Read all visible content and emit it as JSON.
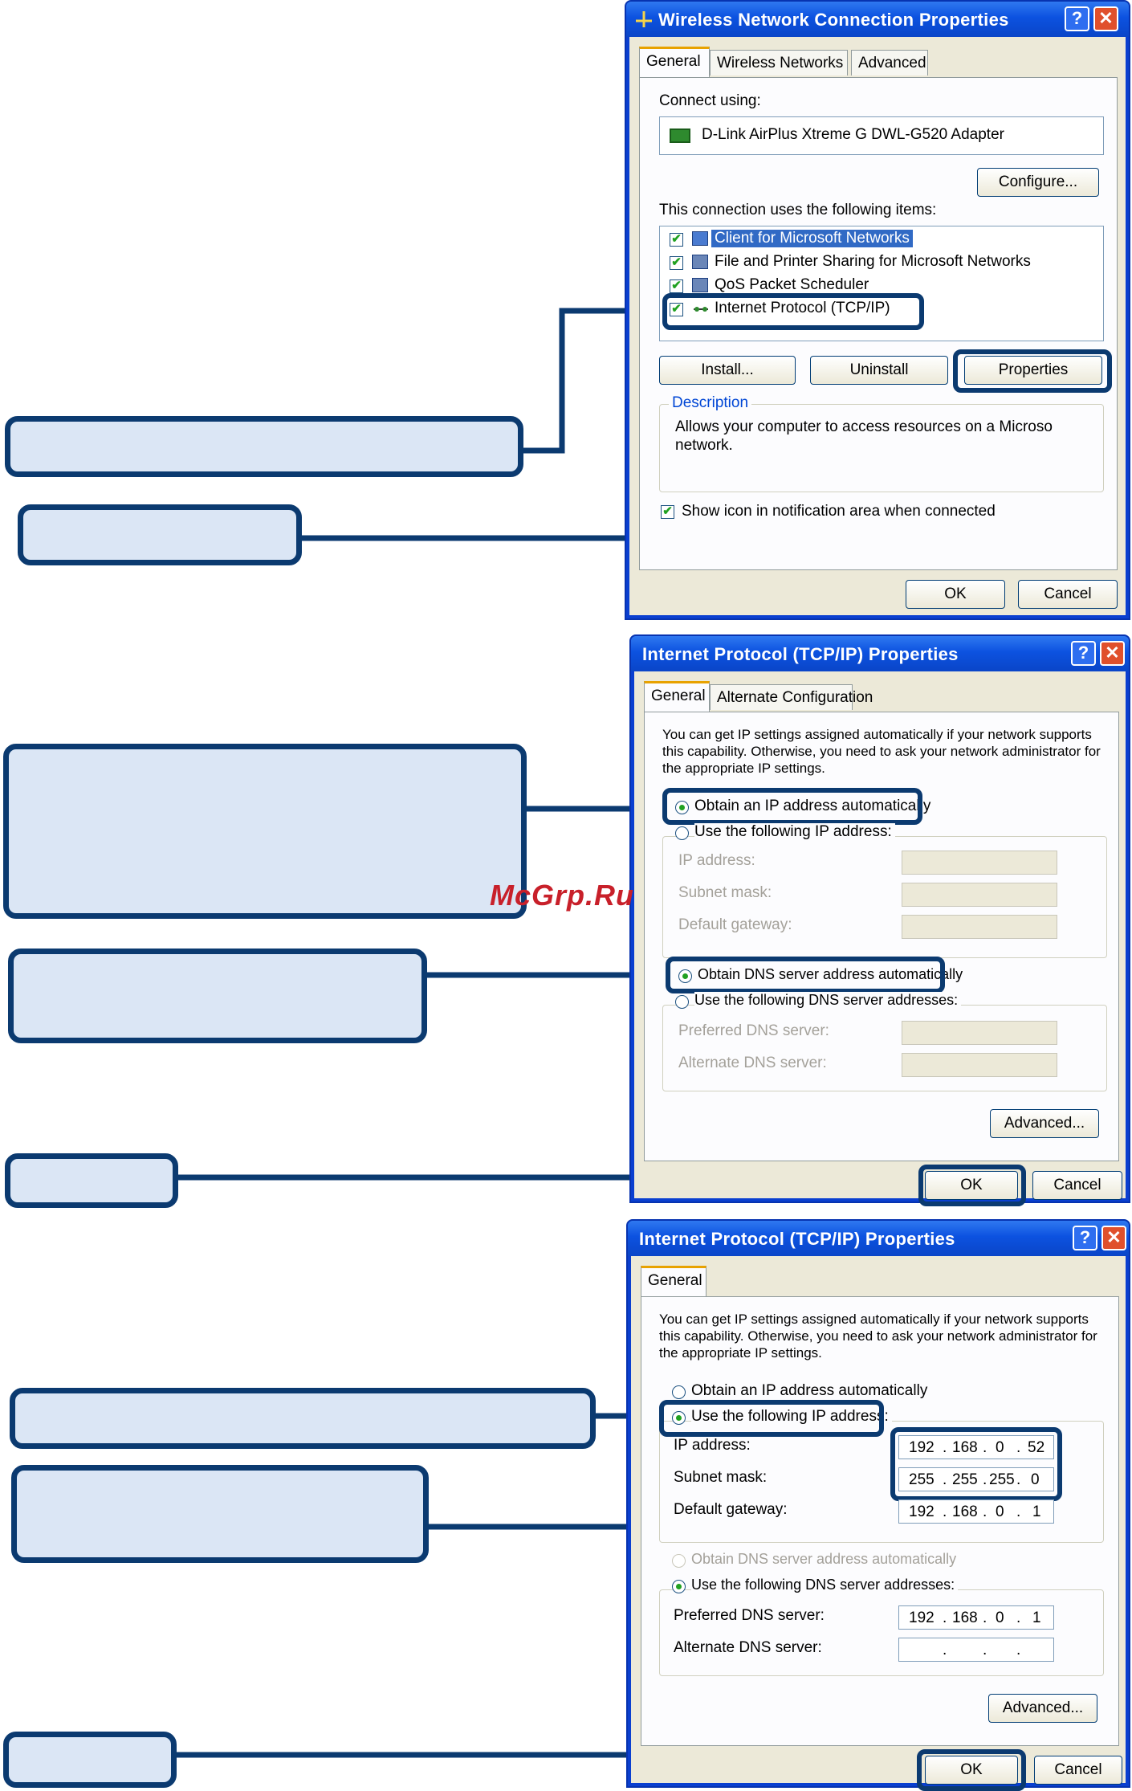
{
  "dialog1": {
    "title": "Wireless Network Connection Properties",
    "tabs": [
      "General",
      "Wireless Networks",
      "Advanced"
    ],
    "connect_using_label": "Connect using:",
    "adapter": "D-Link AirPlus Xtreme G DWL-G520 Adapter",
    "configure_button": "Configure...",
    "items_label": "This connection uses the following items:",
    "items": [
      {
        "label": "Client for Microsoft Networks",
        "checked": true,
        "selected": true
      },
      {
        "label": "File and Printer Sharing for Microsoft Networks",
        "checked": true,
        "selected": false
      },
      {
        "label": "QoS Packet Scheduler",
        "checked": true,
        "selected": false
      },
      {
        "label": "Internet Protocol (TCP/IP)",
        "checked": true,
        "selected": false
      }
    ],
    "install_button": "Install...",
    "uninstall_button": "Uninstall",
    "properties_button": "Properties",
    "description_title": "Description",
    "description_text_1": "Allows your computer to access resources on a Microso",
    "description_text_2": "network.",
    "show_icon_label": "Show icon in notification area when connected",
    "ok_button": "OK",
    "cancel_button": "Cancel"
  },
  "dialog2": {
    "title": "Internet Protocol (TCP/IP) Properties",
    "tabs": [
      "General",
      "Alternate Configuration"
    ],
    "intro_1": "You can get IP settings assigned automatically if your network supports",
    "intro_2": "this capability. Otherwise, you need to ask your network administrator for",
    "intro_3": "the appropriate IP settings.",
    "obtain_ip_auto": "Obtain an IP address automatically",
    "use_following_ip": "Use the following IP address:",
    "ip_address_label": "IP address:",
    "subnet_mask_label": "Subnet mask:",
    "default_gateway_label": "Default gateway:",
    "obtain_dns_auto": "Obtain DNS server address automatically",
    "use_following_dns": "Use the following DNS server addresses:",
    "preferred_dns_label": "Preferred DNS server:",
    "alternate_dns_label": "Alternate DNS server:",
    "advanced_button": "Advanced...",
    "ok_button": "OK",
    "cancel_button": "Cancel"
  },
  "dialog3": {
    "title": "Internet Protocol (TCP/IP) Properties",
    "tabs": [
      "General"
    ],
    "intro_1": "You can get IP settings assigned automatically if your network supports",
    "intro_2": "this capability. Otherwise, you need to ask your network administrator for",
    "intro_3": "the appropriate IP settings.",
    "obtain_ip_auto": "Obtain an IP address automatically",
    "use_following_ip": "Use the following IP address:",
    "ip_address_label": "IP address:",
    "ip_address": [
      "192",
      "168",
      "0",
      "52"
    ],
    "subnet_mask_label": "Subnet mask:",
    "subnet_mask": [
      "255",
      "255",
      "255",
      "0"
    ],
    "default_gateway_label": "Default gateway:",
    "default_gateway": [
      "192",
      "168",
      "0",
      "1"
    ],
    "obtain_dns_auto": "Obtain DNS server address automatically",
    "use_following_dns": "Use the following DNS server addresses:",
    "preferred_dns_label": "Preferred DNS server:",
    "preferred_dns": [
      "192",
      "168",
      "0",
      "1"
    ],
    "alternate_dns_label": "Alternate DNS server:",
    "advanced_button": "Advanced...",
    "ok_button": "OK",
    "cancel_button": "Cancel"
  },
  "watermark": "McGrp.Ru",
  "colors": {
    "callout_fill": "#dbe6f5",
    "callout_border": "#0b3a70",
    "title_bar": "#0c52e0",
    "dialog_bg": "#ece9d8",
    "check_green": "#21a121"
  }
}
